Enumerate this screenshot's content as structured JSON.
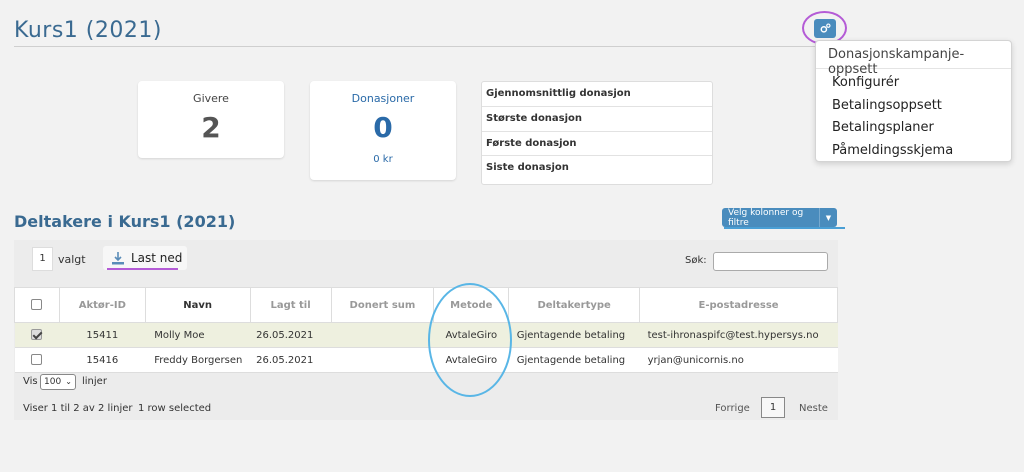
{
  "header": {
    "title": "Kurs1 (2021)"
  },
  "settings_menu": {
    "header": "Donasjonskampanje-oppsett",
    "items": [
      "Konfigurér",
      "Betalingsoppsett",
      "Betalingsplaner",
      "Påmeldingsskjema"
    ]
  },
  "stats": {
    "givers": {
      "label": "Givere",
      "value": "2"
    },
    "donations": {
      "label": "Donasjoner",
      "value": "0",
      "sub": "0 kr"
    }
  },
  "info_rows": [
    "Gjennomsnittlig donasjon",
    "Største donasjon",
    "Første donasjon",
    "Siste donasjon"
  ],
  "section": {
    "title": "Deltakere i Kurs1 (2021)"
  },
  "toolbar": {
    "columns_button": "Velg kolonner og filtre",
    "selected_count": "1",
    "selected_label": "valgt",
    "download_label": "Last ned",
    "search_label": "Søk:",
    "search_value": ""
  },
  "table": {
    "headers": [
      "Aktør-ID",
      "Navn",
      "Lagt til",
      "Donert sum",
      "Metode",
      "Deltakertype",
      "E-postadresse"
    ],
    "rows": [
      {
        "id": "15411",
        "name": "Molly Moe",
        "added": "26.05.2021",
        "donated": "",
        "method": "AvtaleGiro",
        "type": "Gjentagende betaling",
        "email": "test-ihronaspifc@test.hypersys.no",
        "checked": true
      },
      {
        "id": "15416",
        "name": "Freddy Borgersen",
        "added": "26.05.2021",
        "donated": "",
        "method": "AvtaleGiro",
        "type": "Gjentagende betaling",
        "email": "yrjan@unicornis.no",
        "checked": false
      }
    ]
  },
  "footer": {
    "show_label": "Vis",
    "page_size": "100",
    "rows_label": "linjer",
    "info": "Viser 1 til 2 av 2 linjer",
    "selected_info": "1 row selected",
    "prev": "Forrige",
    "page": "1",
    "next": "Neste"
  },
  "colors": {
    "accent": "#4a8cbd",
    "title": "#3a6a91",
    "highlight_purple": "#b45bd6",
    "highlight_blue": "#59b6e6"
  }
}
